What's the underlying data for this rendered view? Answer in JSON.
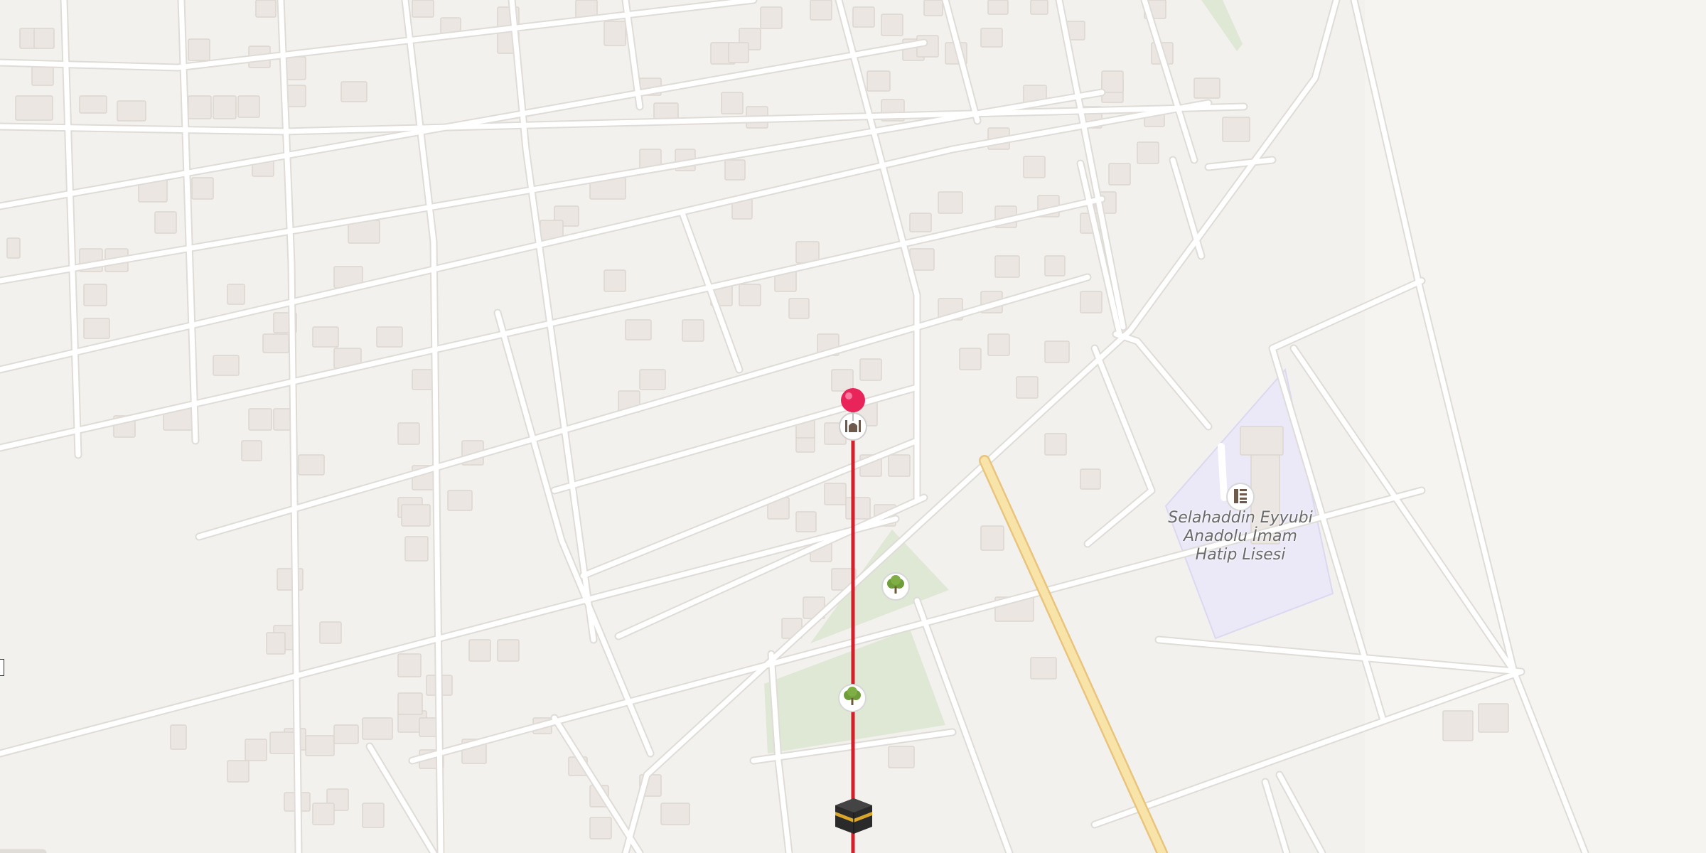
{
  "map": {
    "colors": {
      "background": "#f3f1ee",
      "road": "#ffffff",
      "road_casing": "#dfdcd7",
      "building": "#ebe6e1",
      "building_edge": "#ddd6cf",
      "park": "#dfe8d4",
      "school_area": "#ebe8f7",
      "major_road": "#f8e4a8",
      "major_road_casing": "#e8c47d",
      "qibla_line": "#d4202a",
      "pin": "#e8245a"
    },
    "icons": {
      "pin": "map-pin-icon",
      "mosque": "mosque-icon",
      "tree_1": "tree-icon",
      "tree_2": "tree-icon",
      "school": "school-icon",
      "kaaba": "kaaba-icon"
    }
  },
  "poi": {
    "school_label_lines": [
      "Selahaddin Eyyubi",
      "Anadolu İmam",
      "Hatip Lisesi"
    ]
  }
}
